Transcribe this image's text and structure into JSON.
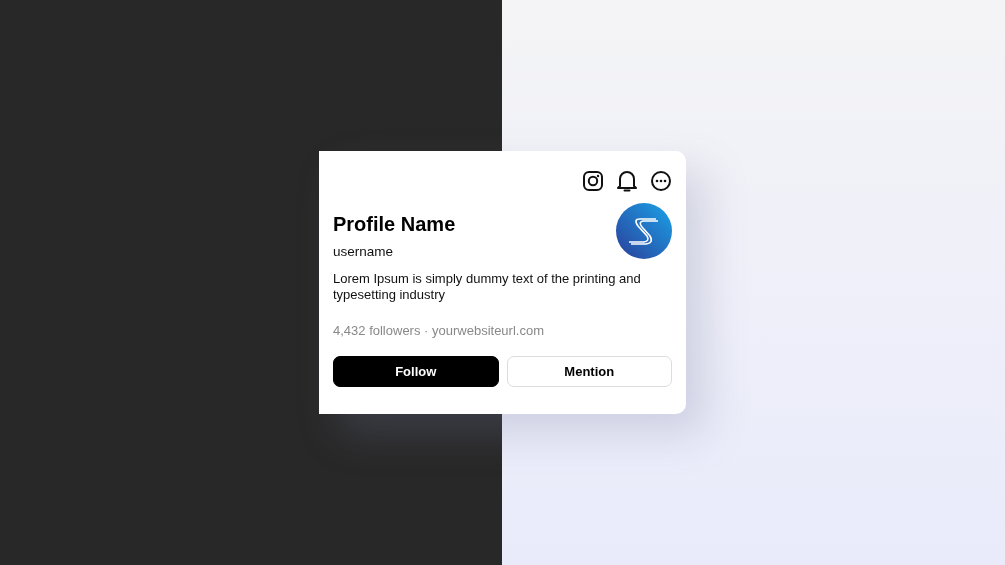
{
  "card": {
    "profile_name": "Profile Name",
    "username": "username",
    "bio": "Lorem Ipsum is simply dummy text of the printing and typesetting industry",
    "stats": "4,432 followers · yourwebsiteurl.com",
    "buttons": [
      {
        "label": "Follow",
        "kind": "primary"
      },
      {
        "label": "Mention",
        "kind": "secondary"
      }
    ]
  }
}
